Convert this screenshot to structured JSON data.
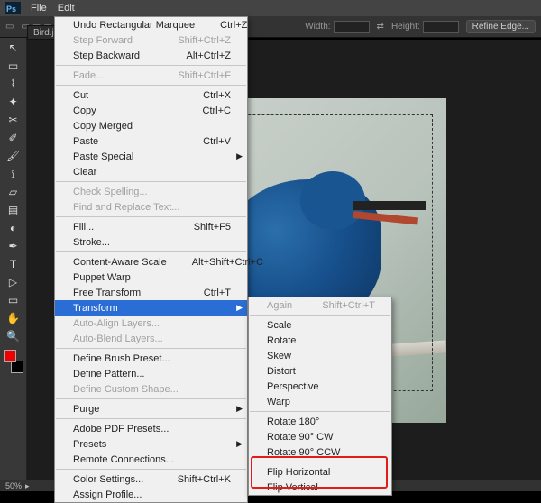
{
  "app": {
    "name": "Ps"
  },
  "menubar": {
    "file": "File",
    "edit": "Edit"
  },
  "optionsbar": {
    "width_label": "Width:",
    "height_label": "Height:",
    "refine": "Refine Edge..."
  },
  "doc": {
    "tab_label": "Bird.jpg @"
  },
  "statusbar": {
    "zoom": "50%"
  },
  "edit_menu": {
    "undo": "Undo Rectangular Marquee",
    "undo_sc": "Ctrl+Z",
    "step_forward": "Step Forward",
    "step_forward_sc": "Shift+Ctrl+Z",
    "step_backward": "Step Backward",
    "step_backward_sc": "Alt+Ctrl+Z",
    "fade": "Fade...",
    "fade_sc": "Shift+Ctrl+F",
    "cut": "Cut",
    "cut_sc": "Ctrl+X",
    "copy": "Copy",
    "copy_sc": "Ctrl+C",
    "copy_merged": "Copy Merged",
    "paste": "Paste",
    "paste_sc": "Ctrl+V",
    "paste_special": "Paste Special",
    "clear": "Clear",
    "check_spelling": "Check Spelling...",
    "find_replace": "Find and Replace Text...",
    "fill": "Fill...",
    "fill_sc": "Shift+F5",
    "stroke": "Stroke...",
    "content_aware": "Content-Aware Scale",
    "content_aware_sc": "Alt+Shift+Ctrl+C",
    "puppet": "Puppet Warp",
    "free_transform": "Free Transform",
    "free_transform_sc": "Ctrl+T",
    "transform": "Transform",
    "auto_align": "Auto-Align Layers...",
    "auto_blend": "Auto-Blend Layers...",
    "define_brush": "Define Brush Preset...",
    "define_pattern": "Define Pattern...",
    "define_custom": "Define Custom Shape...",
    "purge": "Purge",
    "adobe_pdf": "Adobe PDF Presets...",
    "presets": "Presets",
    "remote": "Remote Connections...",
    "color_settings": "Color Settings...",
    "color_settings_sc": "Shift+Ctrl+K",
    "assign_profile": "Assign Profile..."
  },
  "transform_sub": {
    "again": "Again",
    "again_sc": "Shift+Ctrl+T",
    "scale": "Scale",
    "rotate": "Rotate",
    "skew": "Skew",
    "distort": "Distort",
    "perspective": "Perspective",
    "warp": "Warp",
    "rotate_180": "Rotate 180°",
    "rotate_cw": "Rotate 90° CW",
    "rotate_ccw": "Rotate 90° CCW",
    "flip_h": "Flip Horizontal",
    "flip_v": "Flip Vertical"
  }
}
